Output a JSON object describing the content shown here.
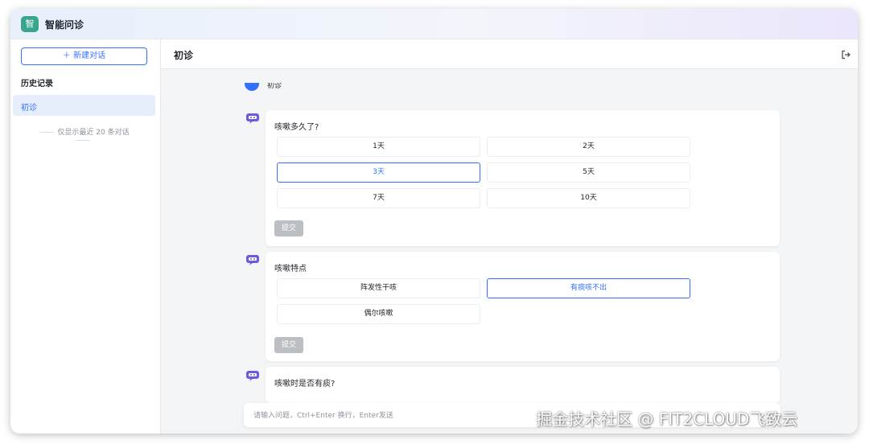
{
  "app": {
    "logo_char": "智",
    "title": "智能问诊"
  },
  "sidebar": {
    "new_chat_label": "＋ 新建对话",
    "history_title": "历史记录",
    "items": [
      {
        "label": "初诊"
      }
    ],
    "note": "仅显示最近 20 条对话"
  },
  "header": {
    "title": "初诊"
  },
  "chat": {
    "user_message": "初诊",
    "questions": [
      {
        "text": "咳嗽多久了?",
        "options": [
          "1天",
          "2天",
          "3天",
          "5天",
          "7天",
          "10天"
        ],
        "selected": "3天",
        "submit_label": "提交"
      },
      {
        "text": "咳嗽特点",
        "options": [
          "阵发性干咳",
          "有痰咳不出",
          "偶尔咳嗽"
        ],
        "selected": "有痰咳不出",
        "submit_label": "提交"
      },
      {
        "text": "咳嗽时是否有痰?"
      }
    ]
  },
  "input": {
    "placeholder": "请输入问题，Ctrl+Enter 换行，Enter发送"
  },
  "watermark": "掘金技术社区 @ FIT2CLOUD飞致云",
  "colors": {
    "accent": "#3370ff",
    "logo": "#3aa58d",
    "bot_icon": "#6a5ae0",
    "disabled_button": "#bbbfc4"
  },
  "icons": {
    "logout": "logout-icon",
    "bot": "robot-icon",
    "plus": "plus-icon"
  }
}
